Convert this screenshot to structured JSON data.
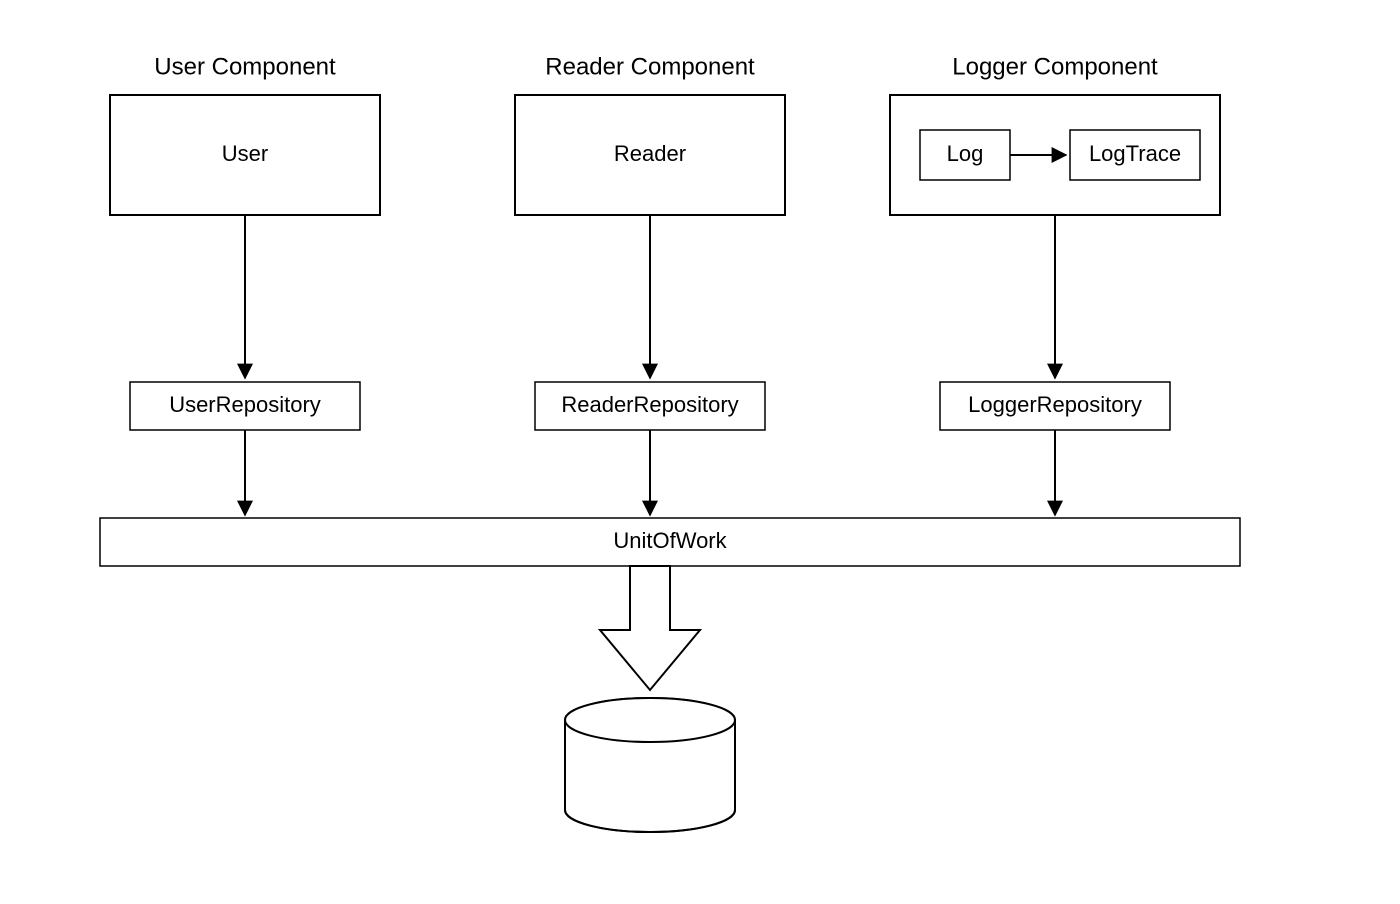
{
  "diagram": {
    "columns": [
      {
        "title": "User Component",
        "component_box": "User",
        "repository": "UserRepository"
      },
      {
        "title": "Reader Component",
        "component_box": "Reader",
        "repository": "ReaderRepository"
      },
      {
        "title": "Logger Component",
        "inner_left": "Log",
        "inner_right": "LogTrace",
        "repository": "LoggerRepository"
      }
    ],
    "unit_of_work": "UnitOfWork",
    "sink": "database"
  }
}
